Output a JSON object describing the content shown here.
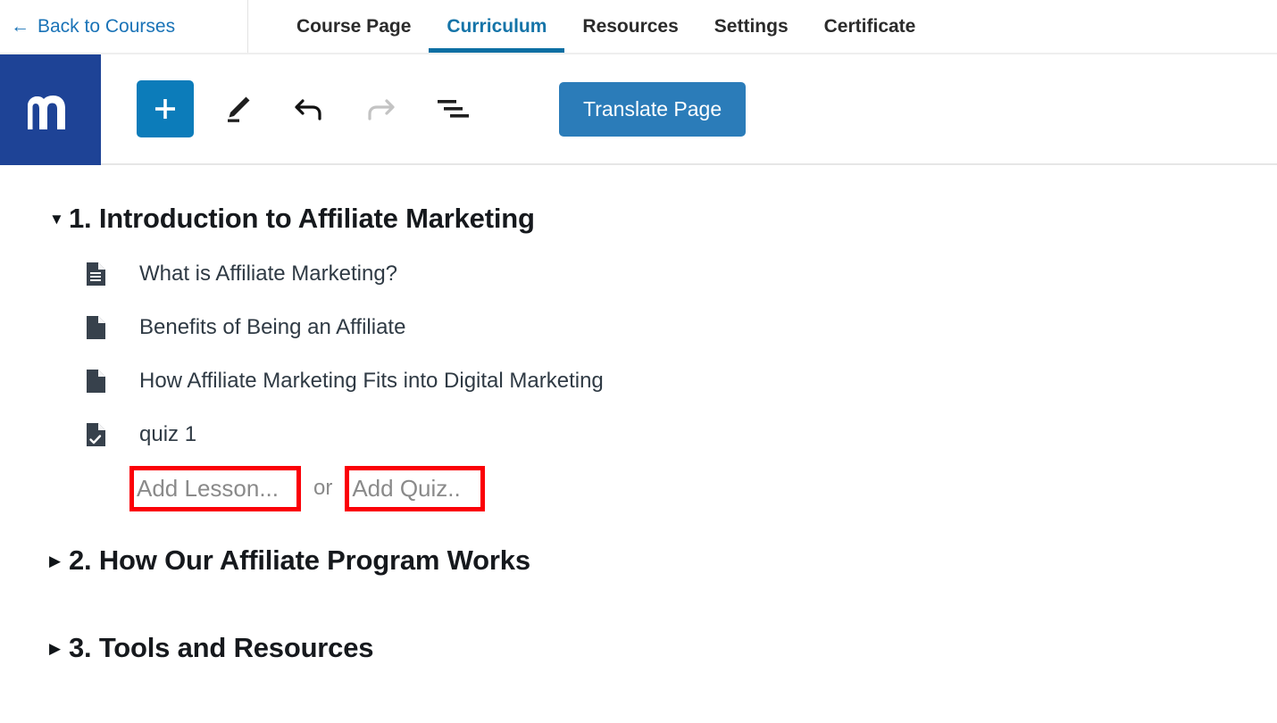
{
  "topbar": {
    "back_link": {
      "icon": "left-arrow-icon",
      "label": "Back to Courses"
    },
    "tabs": [
      {
        "label": "Course Page",
        "active": false
      },
      {
        "label": "Curriculum",
        "active": true
      },
      {
        "label": "Resources",
        "active": false
      },
      {
        "label": "Settings",
        "active": false
      },
      {
        "label": "Certificate",
        "active": false
      }
    ],
    "active_tab_color": "#1574a8",
    "active_underline_color": "#0d6fa3"
  },
  "toolbar": {
    "logo": {
      "name": "moodle-logo",
      "letter": "m",
      "background": "#1e4396"
    },
    "add_button": {
      "icon": "plus-icon",
      "background": "#0c7cba"
    },
    "edit_button": {
      "icon": "pencil-icon"
    },
    "undo_button": {
      "icon": "undo-arrow-icon",
      "enabled": true
    },
    "redo_button": {
      "icon": "redo-arrow-icon",
      "enabled": false
    },
    "outline_button": {
      "icon": "indent-lines-icon"
    },
    "translate_label": "Translate Page",
    "translate_color": "#2b7cb9"
  },
  "curriculum": {
    "sections": [
      {
        "caret": "▼",
        "expanded": true,
        "title": "1. Introduction to Affiliate Marketing",
        "lessons": [
          {
            "icon": "document-text-icon",
            "label": "What is Affiliate Marketing?"
          },
          {
            "icon": "document-blank-icon",
            "label": "Benefits of Being an Affiliate"
          },
          {
            "icon": "document-blank-icon",
            "label": "How Affiliate Marketing Fits into Digital Marketing"
          },
          {
            "icon": "document-check-icon",
            "label": "quiz 1"
          }
        ],
        "add_row": {
          "add_lesson_label": "Add Lesson...",
          "separator_label": "or",
          "add_quiz_label": "Add Quiz..",
          "highlight_color": "#fb0007"
        }
      },
      {
        "caret": "▶",
        "expanded": false,
        "title": "2. How Our Affiliate Program Works",
        "lessons": []
      },
      {
        "caret": "▶",
        "expanded": false,
        "title": "3. Tools and Resources",
        "lessons": []
      }
    ]
  }
}
